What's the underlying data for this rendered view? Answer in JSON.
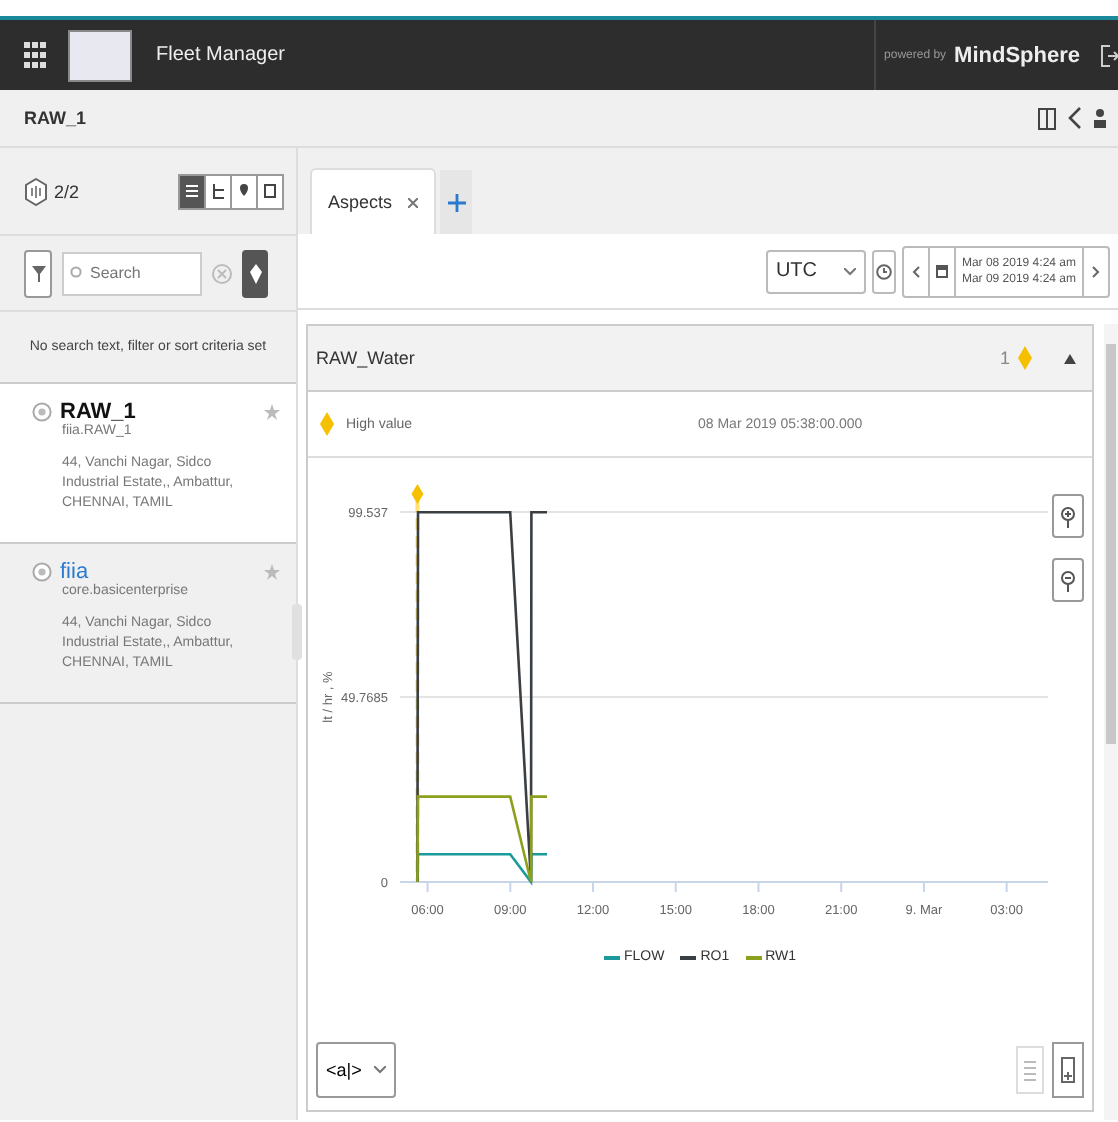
{
  "app_bar": {
    "title": "Fleet Manager",
    "powered_by": "powered by",
    "brand": "MindSphere"
  },
  "breadcrumb": "RAW_1",
  "asset_count": "2/2",
  "view_modes": [
    {
      "kind": "list",
      "selected": true
    },
    {
      "kind": "tree",
      "selected": false
    },
    {
      "kind": "map",
      "selected": false
    },
    {
      "kind": "grid",
      "selected": false
    }
  ],
  "search": {
    "placeholder": "Search"
  },
  "filter_status": "No search text, filter or sort criteria set",
  "assets": [
    {
      "name": "RAW_1",
      "type": "fiia.RAW_1",
      "address": "44, Vanchi Nagar, Sidco Industrial Estate,, Ambattur, CHENNAI, TAMIL",
      "selected": true
    },
    {
      "name": "fiia",
      "type": "core.basicenterprise",
      "address": "44, Vanchi Nagar, Sidco Industrial Estate,, Ambattur, CHENNAI, TAMIL",
      "selected": false
    }
  ],
  "tabs": [
    {
      "label": "Aspects",
      "selected": true
    }
  ],
  "timezone": "UTC",
  "date_range": [
    "Mar 08 2019 4:24 am",
    "Mar 09 2019 4:24 am"
  ],
  "aspect": {
    "title": "RAW_Water",
    "alarm_count": "1",
    "expanded": true,
    "alarm": {
      "label": "High value",
      "time": "08 Mar 2019 05:38:00.000"
    },
    "chart_data": {
      "type": "line",
      "ylabel": "lt / hr , %",
      "x": [
        "2019-03-08T05:38",
        "2019-03-08T05:39",
        "2019-03-08T09:00",
        "2019-03-08T09:45",
        "2019-03-08T09:46",
        "2019-03-08T10:20"
      ],
      "series": [
        {
          "name": "FLOW",
          "color": "#1a9a9a",
          "values": [
            0,
            7.5,
            7.5,
            0,
            7.5,
            7.5
          ]
        },
        {
          "name": "RO1",
          "color": "#3a3f44",
          "values": [
            0,
            99.5,
            99.5,
            0,
            99.5,
            99.5
          ]
        },
        {
          "name": "RW1",
          "color": "#8ca01e",
          "values": [
            0,
            23,
            23,
            0,
            23,
            23
          ]
        }
      ],
      "xlim": [
        "2019-03-08T05:00",
        "2019-03-09T04:30"
      ],
      "ylim": [
        0,
        99.537
      ],
      "xticks": [
        {
          "value": "2019-03-08T06:00",
          "label": "06:00"
        },
        {
          "value": "2019-03-08T09:00",
          "label": "09:00"
        },
        {
          "value": "2019-03-08T12:00",
          "label": "12:00"
        },
        {
          "value": "2019-03-08T15:00",
          "label": "15:00"
        },
        {
          "value": "2019-03-08T18:00",
          "label": "18:00"
        },
        {
          "value": "2019-03-08T21:00",
          "label": "21:00"
        },
        {
          "value": "2019-03-09T00:00",
          "label": "9. Mar"
        },
        {
          "value": "2019-03-09T03:00",
          "label": "03:00"
        }
      ],
      "yticks": [
        {
          "value": 0,
          "label": "0"
        },
        {
          "value": 49.7685,
          "label": "49.7685"
        },
        {
          "value": 99.537,
          "label": "99.537"
        }
      ],
      "ref_lines": [
        {
          "axis": "x",
          "value": "2019-03-08T05:38",
          "color": "#ffe070"
        }
      ]
    },
    "variable_selector": "<a|>"
  }
}
